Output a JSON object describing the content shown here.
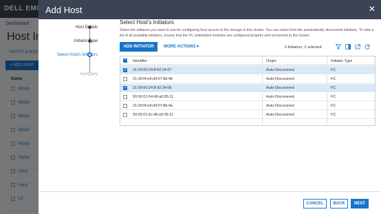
{
  "background": {
    "logo": "DELL EMC",
    "breadcrumb": "Dashboard",
    "page_title": "Host Info",
    "tab": "HOSTS & HOST",
    "add_button": "+ ADD HOST",
    "name_header": "Name",
    "rows": [
      "Windo",
      "Windo",
      "Windo",
      "Windo",
      "Windo",
      "vSphe",
      "Linux",
      "Linux",
      "ic2"
    ]
  },
  "modal": {
    "title": "Add Host",
    "close_icon": "close-icon"
  },
  "steps": [
    {
      "label": "Host Details",
      "state": "done"
    },
    {
      "label": "Initiator Type",
      "state": "done"
    },
    {
      "label": "Select Host's Initiators",
      "state": "active"
    },
    {
      "label": "Summary",
      "state": "pending"
    }
  ],
  "content": {
    "title": "Select Host's Initiators",
    "description": "Select the initiators you want to use for configuring host access to the storage in this cluster. You can select from the automatically discovered initiators. To view a list of all available initiators, ensure that the FC embedded modules are configured properly and connected to the cluster.",
    "add_initiator": "ADD INITIATOR",
    "more_actions": "MORE ACTIONS ▾",
    "count_text": "6 Initiators, 2 selected",
    "tools": [
      "filter-icon",
      "columns-icon",
      "export-icon",
      "refresh-icon"
    ]
  },
  "table": {
    "columns": [
      "Identifier",
      "Origin",
      "Initiator Type"
    ],
    "rows": [
      {
        "identifier": "21:00:00:24:ff:92:24:07",
        "origin": "Auto-Discovered",
        "type": "FC",
        "selected": true
      },
      {
        "identifier": "21:00:f4:e9:d4:57:8b:4b",
        "origin": "Auto-Discovered",
        "type": "FC",
        "selected": false
      },
      {
        "identifier": "21:00:00:24:ff:92:24:06",
        "origin": "Auto-Discovered",
        "type": "FC",
        "selected": true
      },
      {
        "identifier": "50:06:01:64:48:a0:05:11",
        "origin": "Auto-Discovered",
        "type": "FC",
        "selected": false
      },
      {
        "identifier": "21:00:f4:e9:d4:57:8b:4a",
        "origin": "Auto-Discovered",
        "type": "FC",
        "selected": false
      },
      {
        "identifier": "50:06:01:6c:48:a0:05:11",
        "origin": "Auto-Discovered",
        "type": "FC",
        "selected": false
      }
    ]
  },
  "footer": {
    "cancel": "CANCEL",
    "back": "BACK",
    "next": "NEXT"
  },
  "colors": {
    "accent": "#1a73c8",
    "header_bg": "#3b4452",
    "selected_row": "#d9e8f7"
  }
}
